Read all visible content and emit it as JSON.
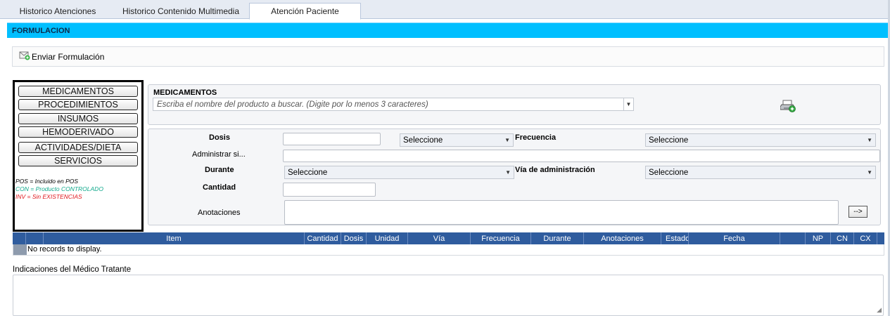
{
  "tabs": [
    {
      "label": "Historico Atenciones",
      "active": false
    },
    {
      "label": "Historico Contenido Multimedia",
      "active": false
    },
    {
      "label": "Atención Paciente",
      "active": true
    }
  ],
  "section": {
    "title": "FORMULACION",
    "accent": "#00BFFF"
  },
  "toolbar": {
    "send_label": "Enviar Formulación",
    "send_icon": "envelope-send-icon"
  },
  "categories": [
    "MEDICAMENTOS",
    "PROCEDIMIENTOS",
    "INSUMOS",
    "HEMODERIVADO",
    "ACTIVIDADES/DIETA",
    "SERVICIOS"
  ],
  "legend": [
    {
      "text": "POS = Incluido en POS",
      "color": "#000000"
    },
    {
      "text": "CON = Producto CONTROLADO",
      "color": "#11A98C"
    },
    {
      "text": "INV = Sin EXISTENCIAS",
      "color": "#E0161C"
    }
  ],
  "search": {
    "title": "MEDICAMENTOS",
    "placeholder": "Escriba el nombre del producto a buscar. (Digite por lo menos 3 caracteres)",
    "add_icon": "printer-add-icon"
  },
  "dose_form": {
    "dosis_label": "Dosis",
    "dosis_value": "",
    "dosis_unit_select": "Seleccione",
    "frecuencia_label": "Frecuencia",
    "frecuencia_select": "Seleccione",
    "administrar_label": "Administrar si...",
    "administrar_value": "",
    "durante_label": "Durante",
    "durante_select": "Seleccione",
    "via_label": "Vía de administración",
    "via_select": "Seleccione",
    "cantidad_label": "Cantidad",
    "cantidad_value": "",
    "anotaciones_label": "Anotaciones",
    "anotaciones_value": "",
    "add_button": "-->"
  },
  "grid": {
    "columns": [
      "Item",
      "Cantidad",
      "Dosis",
      "Unidad",
      "Vía",
      "Frecuencia",
      "Durante",
      "Anotaciones",
      "Estado",
      "Fecha",
      "NP",
      "CN",
      "CX"
    ],
    "empty_text": "No records to display.",
    "header_color": "#2F5C9E"
  },
  "indicaciones": {
    "label": "Indicaciones del Médico Tratante",
    "value": ""
  }
}
